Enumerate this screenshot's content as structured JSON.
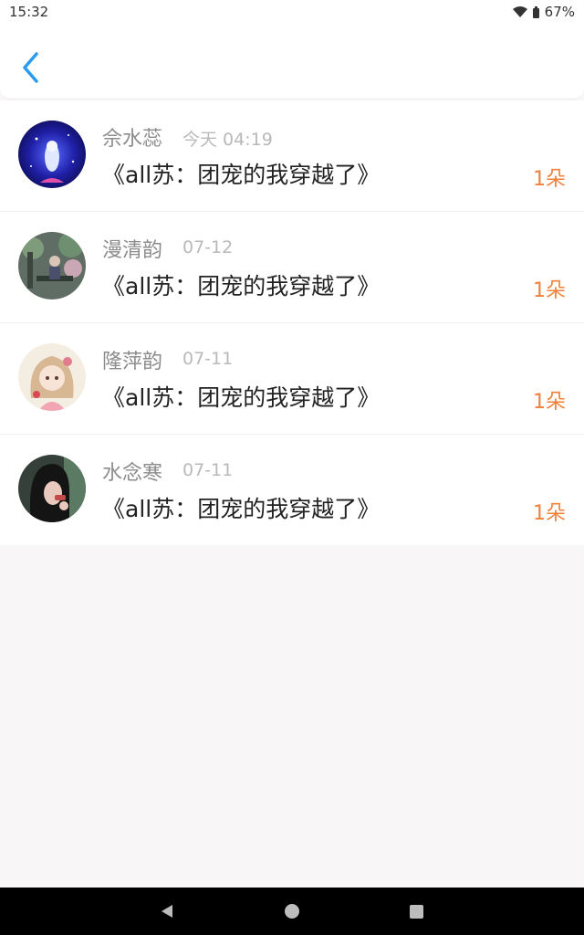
{
  "status_bar": {
    "time": "15:32",
    "battery": "67%"
  },
  "header": {
    "back_icon": "chevron-left-icon",
    "accent_color": "#2b9bf0"
  },
  "gift_color": "#f0803a",
  "items": [
    {
      "name": "佘水蕊",
      "date": "今天 04:19",
      "book": "《all苏：团宠的我穿越了》",
      "gift": "1朵"
    },
    {
      "name": "漫清韵",
      "date": "07-12",
      "book": "《all苏：团宠的我穿越了》",
      "gift": "1朵"
    },
    {
      "name": "隆萍韵",
      "date": "07-11",
      "book": "《all苏：团宠的我穿越了》",
      "gift": "1朵"
    },
    {
      "name": "水念寒",
      "date": "07-11",
      "book": "《all苏：团宠的我穿越了》",
      "gift": "1朵"
    }
  ]
}
